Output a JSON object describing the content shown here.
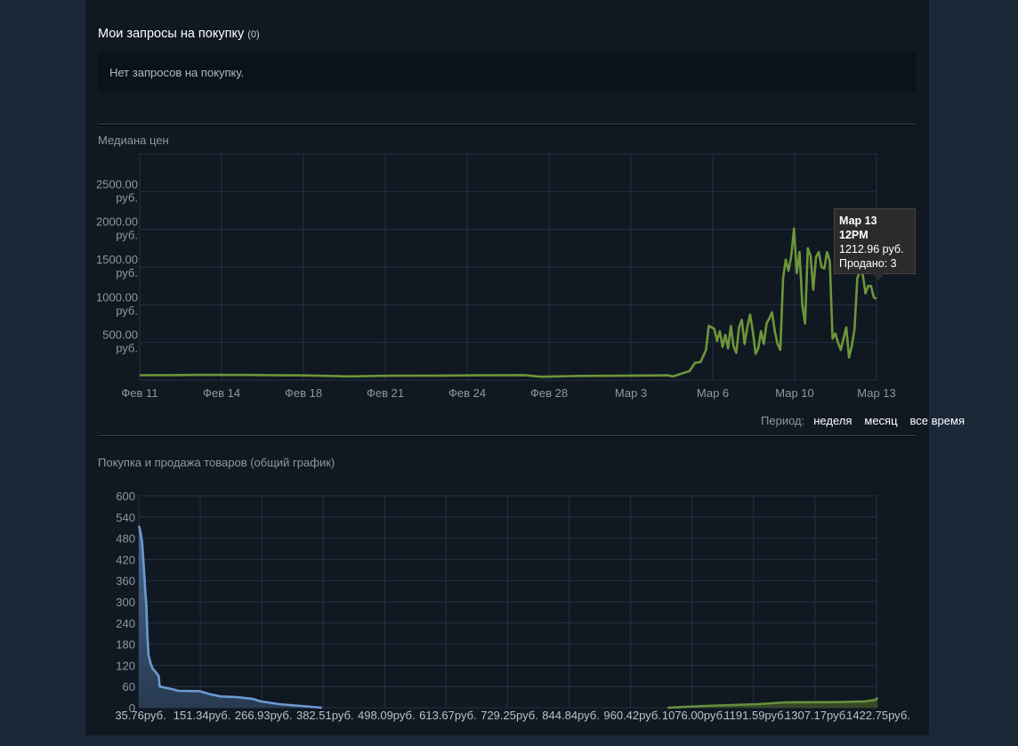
{
  "buy_requests": {
    "title": "Мои запросы на покупку",
    "count": "(0)",
    "empty_text": "Нет запросов на покупку."
  },
  "period": {
    "label": "Период:",
    "options": [
      "неделя",
      "месяц",
      "все время"
    ]
  },
  "tooltip": {
    "date": "Мар 13",
    "time": "12PM",
    "price": "1212.96 руб.",
    "sold": "Продано: 3"
  },
  "colors": {
    "price_line": "#6d963a",
    "buy_line": "#6c9ad1",
    "sell_line": "#688f3e",
    "grid": "#243240"
  },
  "chart_data": [
    {
      "type": "line",
      "title": "Медиана цен",
      "xlabel": "",
      "ylabel": "",
      "x_tick_labels": [
        "Фев 11",
        "Фев 14",
        "Фев 18",
        "Фев 21",
        "Фев 24",
        "Фев 28",
        "Мар 3",
        "Мар 6",
        "Мар 10",
        "Мар 13"
      ],
      "y_tick_values": [
        500,
        1000,
        1500,
        2000,
        2500
      ],
      "y_tick_labels": [
        [
          "500.00",
          "руб."
        ],
        [
          "1000.00",
          "руб."
        ],
        [
          "1500.00",
          "руб."
        ],
        [
          "2000.00",
          "руб."
        ],
        [
          "2500.00",
          "руб."
        ]
      ],
      "ylim": [
        0,
        3000
      ],
      "grid": true,
      "series": [
        {
          "points": [
            [
              0,
              65
            ],
            [
              5,
              66
            ],
            [
              12,
              70
            ],
            [
              20,
              68
            ],
            [
              25,
              64
            ],
            [
              30,
              63
            ],
            [
              38,
              50
            ],
            [
              45,
              58
            ],
            [
              55,
              60
            ],
            [
              62,
              64
            ],
            [
              70,
              66
            ],
            [
              73,
              45
            ],
            [
              76,
              50
            ],
            [
              80,
              56
            ],
            [
              87,
              58
            ],
            [
              93,
              62
            ],
            [
              96,
              64
            ],
            [
              97,
              50
            ],
            [
              100,
              120
            ],
            [
              101,
              230
            ],
            [
              102,
              240
            ],
            [
              103,
              400
            ],
            [
              103.5,
              720
            ],
            [
              104,
              700
            ],
            [
              104.5,
              680
            ],
            [
              105,
              520
            ],
            [
              105.5,
              650
            ],
            [
              106,
              440
            ],
            [
              106.5,
              600
            ],
            [
              107,
              420
            ],
            [
              107.5,
              720
            ],
            [
              108,
              450
            ],
            [
              108.5,
              360
            ],
            [
              109,
              700
            ],
            [
              109.5,
              800
            ],
            [
              110,
              480
            ],
            [
              110.5,
              700
            ],
            [
              111,
              870
            ],
            [
              111.5,
              650
            ],
            [
              112,
              350
            ],
            [
              112.5,
              420
            ],
            [
              113,
              650
            ],
            [
              113.5,
              480
            ],
            [
              114,
              750
            ],
            [
              114.5,
              820
            ],
            [
              115,
              900
            ],
            [
              115.5,
              650
            ],
            [
              116,
              480
            ],
            [
              116.5,
              400
            ],
            [
              117,
              1350
            ],
            [
              117.5,
              1600
            ],
            [
              118,
              1450
            ],
            [
              118.5,
              1650
            ],
            [
              119,
              2010
            ],
            [
              119.5,
              1420
            ],
            [
              120,
              1700
            ],
            [
              120.5,
              1000
            ],
            [
              121,
              750
            ],
            [
              121.5,
              1750
            ],
            [
              122,
              1650
            ],
            [
              122.5,
              1200
            ],
            [
              123,
              1630
            ],
            [
              123.5,
              1700
            ],
            [
              124,
              1500
            ],
            [
              124.5,
              1480
            ],
            [
              125,
              1700
            ],
            [
              125.5,
              1580
            ],
            [
              126,
              550
            ],
            [
              126.5,
              620
            ],
            [
              127,
              500
            ],
            [
              127.5,
              400
            ],
            [
              128,
              550
            ],
            [
              128.5,
              700
            ],
            [
              129,
              300
            ],
            [
              129.5,
              450
            ],
            [
              130,
              680
            ],
            [
              130.5,
              1350
            ],
            [
              131,
              1450
            ],
            [
              131.5,
              1400
            ],
            [
              132,
              1150
            ],
            [
              132.5,
              1250
            ],
            [
              133,
              1250
            ],
            [
              133.5,
              1100
            ],
            [
              134,
              1080
            ]
          ]
        }
      ]
    },
    {
      "type": "area",
      "title": "Покупка и продажа товаров (общий график)",
      "xlabel": "",
      "ylabel": "",
      "x_tick_labels": [
        "35.76руб.",
        "151.34руб.",
        "266.93руб.",
        "382.51руб.",
        "498.09руб.",
        "613.67руб.",
        "729.25руб.",
        "844.84руб.",
        "960.42руб.",
        "1076.00руб.",
        "1191.59руб.",
        "1307.17руб.",
        "1422.75руб."
      ],
      "y_tick_labels": [
        "0",
        "60",
        "120",
        "180",
        "240",
        "300",
        "360",
        "420",
        "480",
        "540",
        "600"
      ],
      "ylim": [
        0,
        600
      ],
      "grid": true,
      "series": [
        {
          "points": [
            [
              35.76,
              515
            ],
            [
              38,
              505
            ],
            [
              42,
              470
            ],
            [
              46,
              380
            ],
            [
              48,
              330
            ],
            [
              50,
              290
            ],
            [
              52,
              200
            ],
            [
              54,
              150
            ],
            [
              58,
              125
            ],
            [
              62,
              110
            ],
            [
              68,
              100
            ],
            [
              73,
              90
            ],
            [
              75,
              60
            ],
            [
              100,
              52
            ],
            [
              110,
              48
            ],
            [
              150,
              47
            ],
            [
              170,
              38
            ],
            [
              190,
              32
            ],
            [
              220,
              30
            ],
            [
              250,
              25
            ],
            [
              265,
              18
            ],
            [
              300,
              10
            ],
            [
              340,
              5
            ],
            [
              380,
              0
            ]
          ]
        },
        {
          "points": [
            [
              1030,
              0
            ],
            [
              1100,
              5
            ],
            [
              1200,
              10
            ],
            [
              1250,
              15
            ],
            [
              1350,
              16
            ],
            [
              1400,
              18
            ],
            [
              1420,
              22
            ],
            [
              1425,
              28
            ]
          ]
        }
      ]
    }
  ]
}
